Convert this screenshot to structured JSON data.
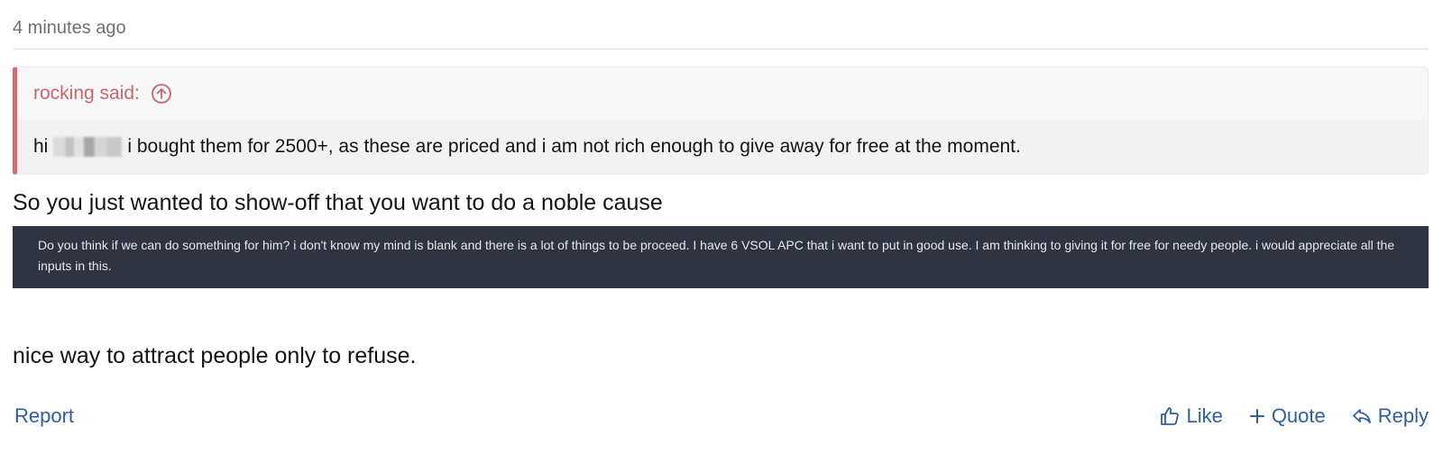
{
  "post": {
    "timestamp": "4 minutes ago",
    "quote": {
      "author_line": "rocking said:",
      "body_prefix": "hi",
      "body_text": "i bought them for 2500+, as these are priced and i am not rich enough to give away for free at the moment."
    },
    "line1": "So you just wanted to show-off that you want to do a noble cause",
    "embedded_screenshot_text": "Do you think if we can do something for him? i don't know my mind is blank and there is a lot of things to be proceed. I have 6 VSOL APC that i want to put in good use. I am thinking to giving it for free for needy people. i would appreciate all the inputs in this.",
    "line2": "nice way to attract people only to refuse.",
    "actions": {
      "report": "Report",
      "like": "Like",
      "quote": "Quote",
      "reply": "Reply"
    }
  },
  "colors": {
    "quote_accent": "#cc6f77",
    "link": "#2f5f9e",
    "dark_box": "#2f3440"
  },
  "icons": {
    "quote_jump": "arrow-up-circle-icon",
    "like": "thumbs-up-icon",
    "quote": "plus-icon",
    "reply": "reply-arrow-icon"
  }
}
